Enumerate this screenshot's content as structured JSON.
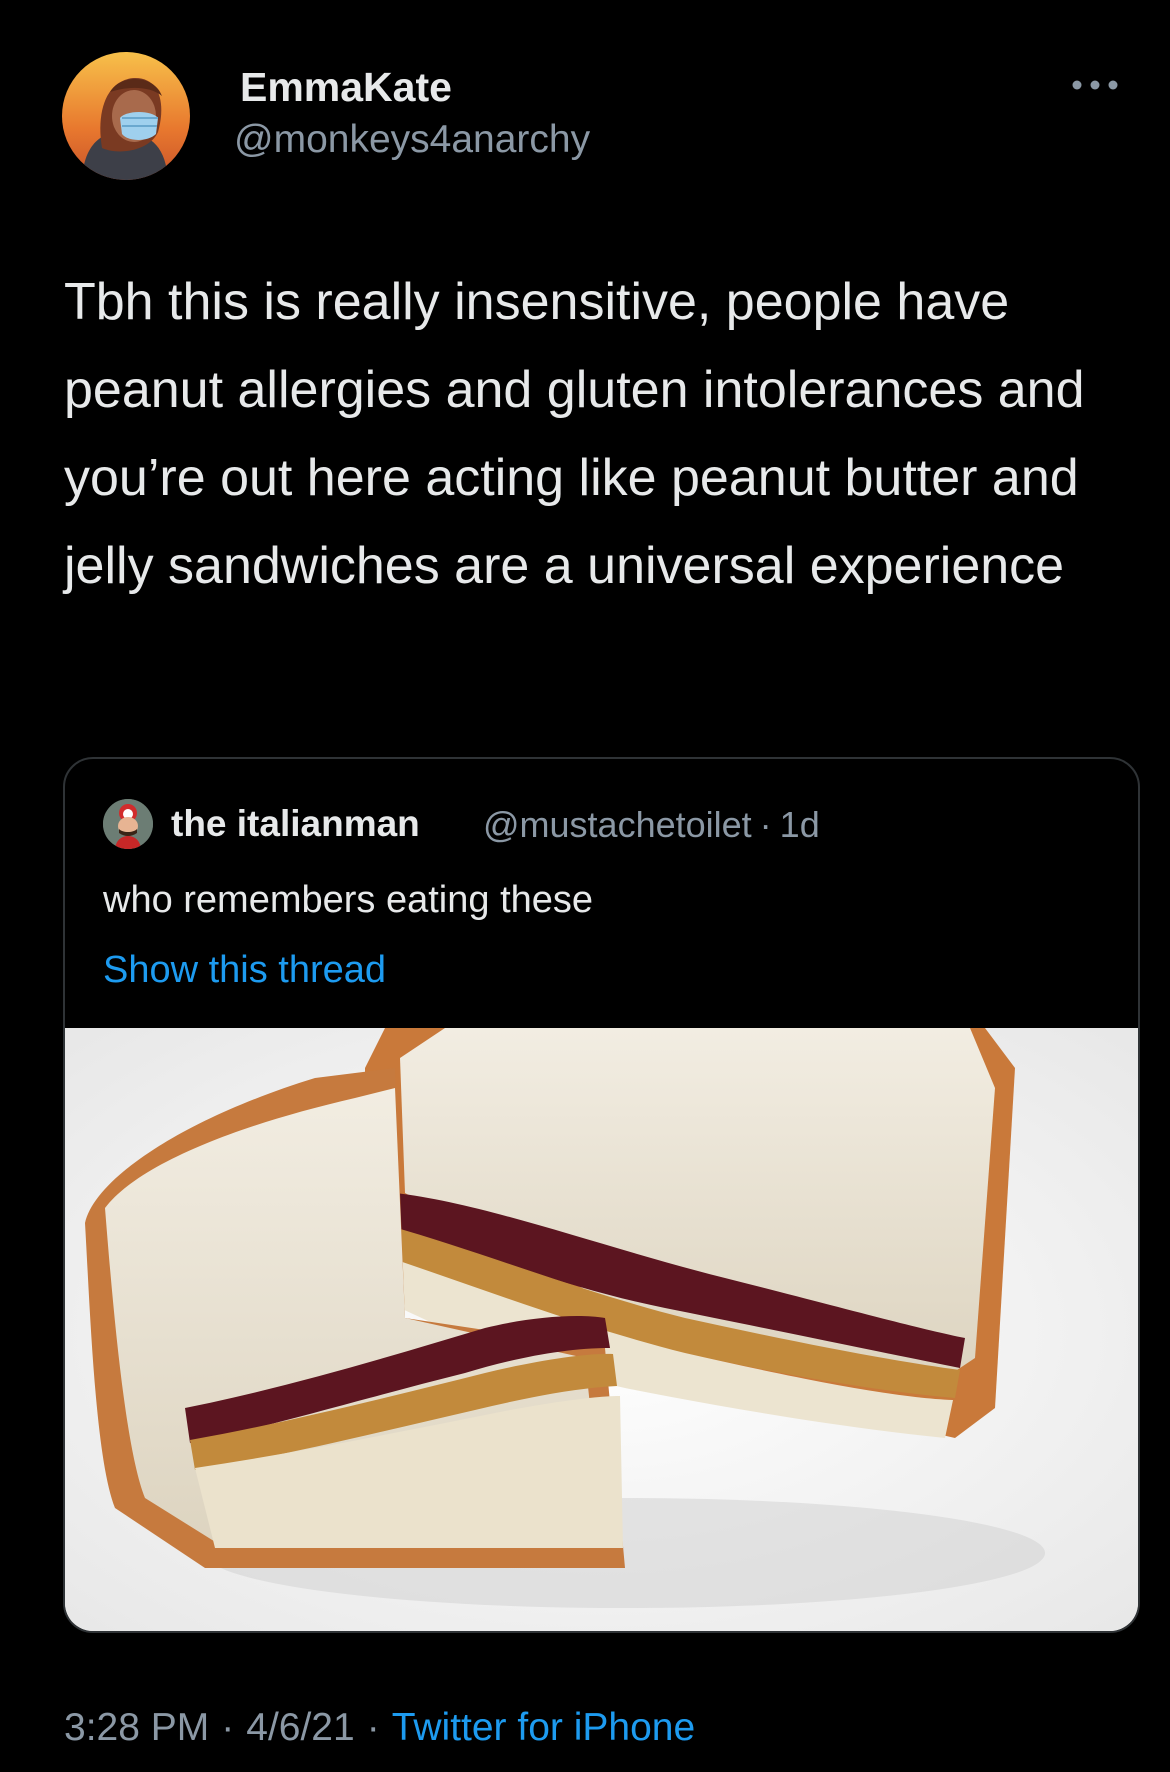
{
  "tweet": {
    "author": {
      "display_name": "EmmaKate",
      "handle": "@monkeys4anarchy",
      "avatar_icon": "avatar-illustration-masked-person"
    },
    "text": "Tbh this is really insensitive, people have peanut allergies and gluten intolerances and you’re out here acting like peanut butter and jelly sandwiches are a universal experience",
    "more_icon": "more-horizontal-icon"
  },
  "quote": {
    "author": {
      "display_name": "the italianman",
      "handle": "@mustachetoilet",
      "time": "1d"
    },
    "text": "who remembers eating these",
    "show_thread": "Show this thread",
    "media_icon": "pbj-sandwich-image"
  },
  "footer": {
    "time": "3:28 PM",
    "date": "4/6/21",
    "source": "Twitter for iPhone",
    "separator": "·"
  },
  "colors": {
    "background": "#000000",
    "text": "#e7e9ea",
    "secondary": "#8b98a5",
    "link": "#1d9bf0",
    "border": "#2f3336"
  }
}
